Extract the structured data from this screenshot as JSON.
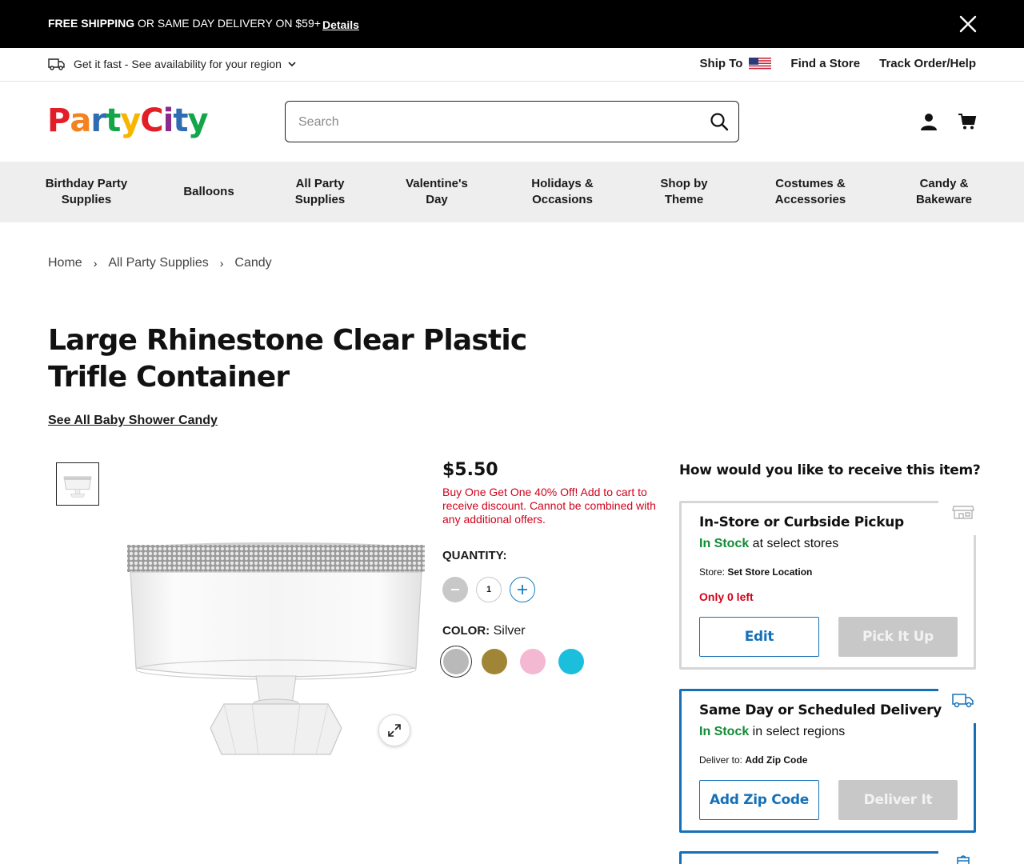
{
  "promo": {
    "bold_text": "FREE SHIPPING",
    "text": " OR SAME DAY DELIVERY ON $59+",
    "details_link": "Details",
    "close_icon": "close-icon"
  },
  "utility": {
    "delivery_text": "Get it fast - See availability for your region",
    "ship_to": "Ship To",
    "find_store": "Find a Store",
    "track_order": "Track Order/Help"
  },
  "header": {
    "logo_text": "PartyCity",
    "logo_colors": [
      "#e21e26",
      "#f58220",
      "#2e6db4",
      "#13a54a",
      "#f7b500",
      "#e21e26",
      "#8a2a8c",
      "#2e6db4",
      "#13a54a"
    ],
    "search_placeholder": "Search"
  },
  "nav": [
    "Birthday Party\nSupplies",
    "Balloons",
    "All Party\nSupplies",
    "Valentine's\nDay",
    "Holidays &\nOccasions",
    "Shop by\nTheme",
    "Costumes &\nAccessories",
    "Candy &\nBakeware"
  ],
  "breadcrumb": [
    "Home",
    "All Party Supplies",
    "Candy"
  ],
  "product": {
    "title": "Large Rhinestone Clear Plastic Trifle Container",
    "see_all": "See All Baby Shower Candy",
    "price": "$5.50",
    "promo_message": "Buy One Get One 40% Off! Add to cart to receive discount. Cannot be combined with any additional offers.",
    "quantity_label": "QUANTITY:",
    "quantity": "1",
    "color_label": "COLOR:",
    "color_value": "Silver",
    "swatches": [
      {
        "name": "Silver",
        "color": "#b9b9b9",
        "selected": true
      },
      {
        "name": "Gold",
        "color": "#a08537",
        "selected": false
      },
      {
        "name": "Pink",
        "color": "#f3b8d2",
        "selected": false
      },
      {
        "name": "Turquoise",
        "color": "#1bbfdc",
        "selected": false
      }
    ]
  },
  "receive": {
    "question": "How would you like to receive this item?",
    "pickup": {
      "title": "In-Store or Curbside Pickup",
      "stock_status": "In Stock",
      "stock_suffix": " at select stores",
      "store_label": "Store:",
      "store_value": "Set Store Location",
      "left_text": "Only 0 left",
      "edit_button": "Edit",
      "action_button": "Pick It Up"
    },
    "delivery": {
      "title": "Same Day or Scheduled Delivery",
      "stock_status": "In Stock",
      "stock_suffix": " in select regions",
      "deliver_label": "Deliver to:",
      "deliver_value": "Add Zip Code",
      "zip_button": "Add Zip Code",
      "action_button": "Deliver It"
    }
  },
  "colors": {
    "accent_blue": "#1570b8",
    "sale_red": "#d0021b",
    "stock_green": "#138a36"
  }
}
